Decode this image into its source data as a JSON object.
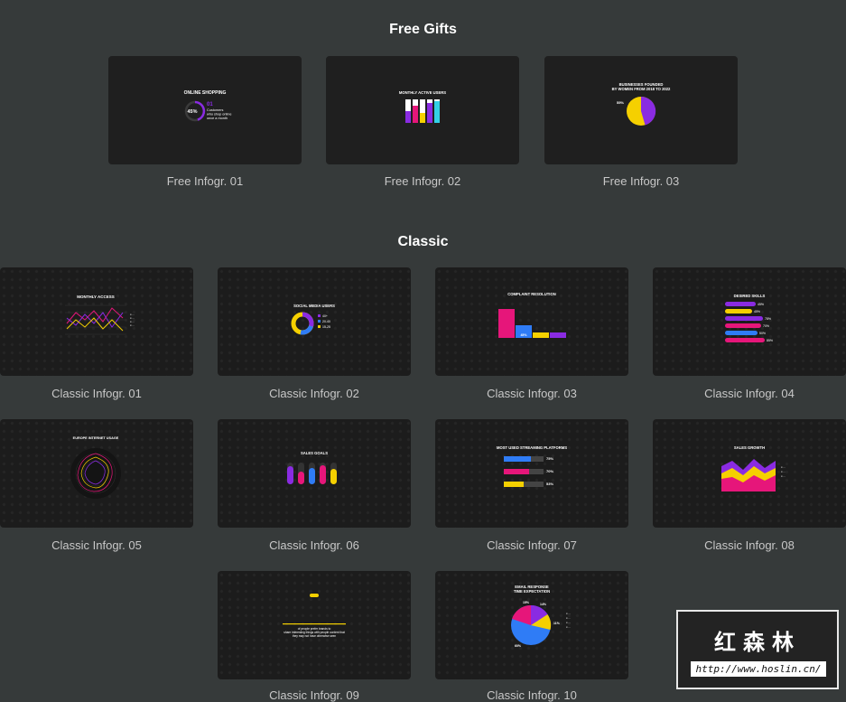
{
  "sections": [
    {
      "title": "Free Gifts"
    },
    {
      "title": "Classic"
    }
  ],
  "cards": [
    {
      "label": "Free Infogr. 01",
      "thumb_title": "ONLINE SHOPPING",
      "pct": "45%",
      "big": "01",
      "caption": [
        "Customers",
        "who shop online",
        "once a month"
      ]
    },
    {
      "label": "Free Infogr. 02",
      "thumb_title": "MONTHLY ACTIVE USERS"
    },
    {
      "label": "Free Infogr. 03",
      "thumb_title": [
        "BUSINESSES FOUNDED",
        "BY WOMEN FROM 2018 TO 2022"
      ],
      "pct": "55%"
    },
    {
      "label": "Classic Infogr. 01",
      "thumb_title": "MONTHLY ACCESS"
    },
    {
      "label": "Classic Infogr. 02",
      "thumb_title": "SOCIAL MEDIA USERS",
      "legend": [
        "40+",
        "20-40",
        "15-25"
      ]
    },
    {
      "label": "Classic Infogr. 03",
      "thumb_title": "COMPLAINT RESOLUTION",
      "values": [
        "45%"
      ]
    },
    {
      "label": "Classic Infogr. 04",
      "thumb_title": "DESIRED SKILLS",
      "values": [
        "45%",
        "45%",
        "78%",
        "70%",
        "50%",
        "85%"
      ]
    },
    {
      "label": "Classic Infogr. 05",
      "thumb_title": "EUROPE INTERNET USAGE"
    },
    {
      "label": "Classic Infogr. 06",
      "thumb_title": "SALES GOALS"
    },
    {
      "label": "Classic Infogr. 07",
      "thumb_title": "MOST USED STREAMING PLATFORMS",
      "values": [
        "75%",
        "70%",
        "53%"
      ]
    },
    {
      "label": "Classic Infogr. 08",
      "thumb_title": "SALES GROWTH"
    },
    {
      "label": "Classic Infogr. 09",
      "thumb_caption": [
        "of people prefer brands to",
        "share interesting things with people content that",
        "they may not have otherwise seen"
      ]
    },
    {
      "label": "Classic Infogr. 10",
      "thumb_title": [
        "EMAIL RESPONSE",
        "TIME EXPECTATION"
      ],
      "values": [
        "15%",
        "14%",
        "11%",
        "60%"
      ]
    }
  ],
  "colors": {
    "background": "#363a3a",
    "card": "#1f1f1f",
    "purple": "#8a2be2",
    "pink": "#e6167a",
    "yellow": "#f5d000",
    "blue": "#2f7cf6",
    "cyan": "#33d0e6"
  },
  "watermark": {
    "text_cn": "红森林",
    "url": "http://www.hoslin.cn/"
  }
}
